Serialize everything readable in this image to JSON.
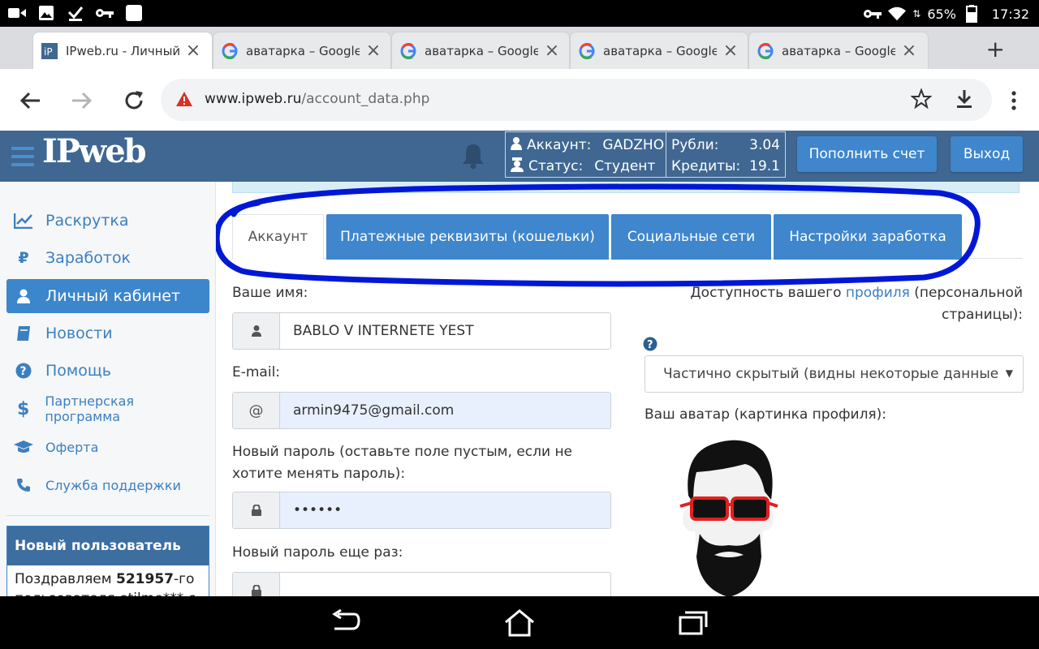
{
  "status_bar": {
    "battery": "65%",
    "time": "17:32"
  },
  "browser": {
    "tabs": [
      {
        "title": "IPweb.ru - Личный к",
        "active": true
      },
      {
        "title": "аватарка – Google П",
        "active": false
      },
      {
        "title": "аватарка – Google П",
        "active": false
      },
      {
        "title": "аватарка – Google П",
        "active": false
      },
      {
        "title": "аватарка – Google П",
        "active": false
      }
    ],
    "url_host": "www.ipweb.ru",
    "url_path": "/account_data.php"
  },
  "header": {
    "logo": "IPweb",
    "account_label": "Аккаунт:",
    "account_value": "GADZHO",
    "status_label": "Статус:",
    "status_value": "Студент",
    "rubles_label": "Рубли:",
    "rubles_value": "3.04",
    "credits_label": "Кредиты:",
    "credits_value": "19.1",
    "topup_button": "Пополнить счет",
    "logout_button": "Выход"
  },
  "sidebar": {
    "items": [
      {
        "label": "Раскрутка"
      },
      {
        "label": "Заработок"
      },
      {
        "label": "Личный кабинет"
      },
      {
        "label": "Новости"
      },
      {
        "label": "Помощь"
      },
      {
        "label": "Партнерская программа"
      },
      {
        "label": "Оферта"
      },
      {
        "label": "Служба поддержки"
      }
    ],
    "new_user": {
      "title": "Новый пользователь",
      "text_prefix": "Поздравляем ",
      "number": "521957",
      "text_suffix": "-го",
      "line2": "пользователя etilme*** с"
    }
  },
  "profile_tabs": [
    {
      "label": "Аккаунт"
    },
    {
      "label": "Платежные реквизиты (кошельки)"
    },
    {
      "label": "Социальные сети"
    },
    {
      "label": "Настройки заработка"
    }
  ],
  "form": {
    "name_label": "Ваше имя:",
    "name_value": "BABLO V INTERNETE YEST",
    "email_label": "E-mail:",
    "email_addon": "@",
    "email_value": "armin9475@gmail.com",
    "password_label_1": "Новый пароль (оставьте поле пустым, если не",
    "password_label_2": "хотите менять пароль):",
    "password_value": "••••••",
    "password_repeat_label": "Новый пароль еще раз:",
    "visibility_label_prefix": "Доступность вашего ",
    "visibility_link": "профиля",
    "visibility_label_suffix": " (персональной",
    "visibility_label_line2": "страницы):",
    "visibility_value": "Частично скрытый (видны некоторые данные",
    "avatar_label": "Ваш аватар (картинка профиля):"
  },
  "colors": {
    "header_bg": "#3f6791",
    "accent": "#3f86cc",
    "link": "#3c7fc0",
    "annotation": "#0018d6"
  }
}
